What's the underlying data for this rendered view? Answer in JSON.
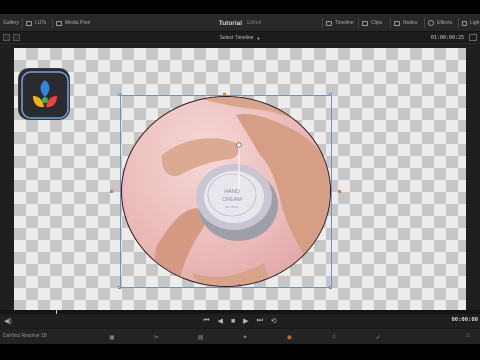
{
  "toolbar": {
    "gallery": "Gallery",
    "luts": "LUTs",
    "media_pool": "Media Pool",
    "project_title": "Tutorial",
    "project_status": "Edited",
    "timeline": "Timeline",
    "clips": "Clips",
    "nodes": "Nodes",
    "effects": "Effects",
    "lightbox": "Ligh"
  },
  "subbar": {
    "timeline_selector": "Select Timeline",
    "timecode": "01:00:00:25"
  },
  "viewer": {
    "jar_label_line1": "HAND",
    "jar_label_line2": "CREAM",
    "jar_label_line3": "NATURAL"
  },
  "playback": {
    "timecode": "00:00:00",
    "skip_first": "⏮",
    "step_back": "◀",
    "stop": "■",
    "play": "▶",
    "skip_last": "⏭",
    "loop": "⟲"
  },
  "footer": {
    "brand": "DaVinci Resolve 18",
    "pages": [
      "media",
      "cut",
      "edit",
      "fusion",
      "color",
      "fairlight",
      "deliver"
    ],
    "page_icons": [
      "▣",
      "✂",
      "▤",
      "✦",
      "◉",
      "♫",
      "➶"
    ],
    "active_page": "color",
    "home": "⌂"
  },
  "colors": {
    "accent": "#e07a2b",
    "selection": "#6b8fd0"
  }
}
